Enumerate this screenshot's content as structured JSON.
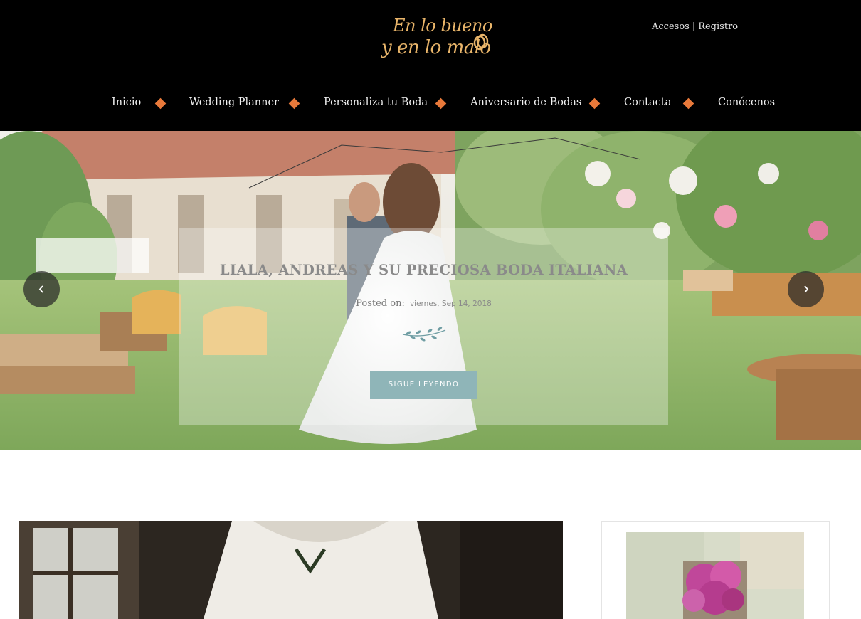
{
  "header": {
    "logo": {
      "line1": "En lo bueno",
      "line2": "y en lo malo"
    },
    "top_links": {
      "login": "Accesos",
      "separator": "|",
      "register": "Registro"
    },
    "nav": [
      {
        "label": "Inicio"
      },
      {
        "label": "Wedding Planner"
      },
      {
        "label": "Personaliza tu Boda"
      },
      {
        "label": "Aniversario de Bodas"
      },
      {
        "label": "Contacta"
      },
      {
        "label": "Conócenos"
      }
    ]
  },
  "hero": {
    "title": "LIALA, ANDREAS Y SU PRECIOSA BODA ITALIANA",
    "posted_label": "Posted on:",
    "posted_date": "viernes, Sep 14, 2018",
    "cta_label": "SIGUE LEYENDO",
    "prev_icon": "chevron-left-icon",
    "next_icon": "chevron-right-icon"
  },
  "colors": {
    "header_bg": "#000000",
    "logo_gold": "#e9b56a",
    "nav_diamond": "#e8793a",
    "cta_bg": "#8fb5b8",
    "caption_title": "#8a8a8a"
  }
}
